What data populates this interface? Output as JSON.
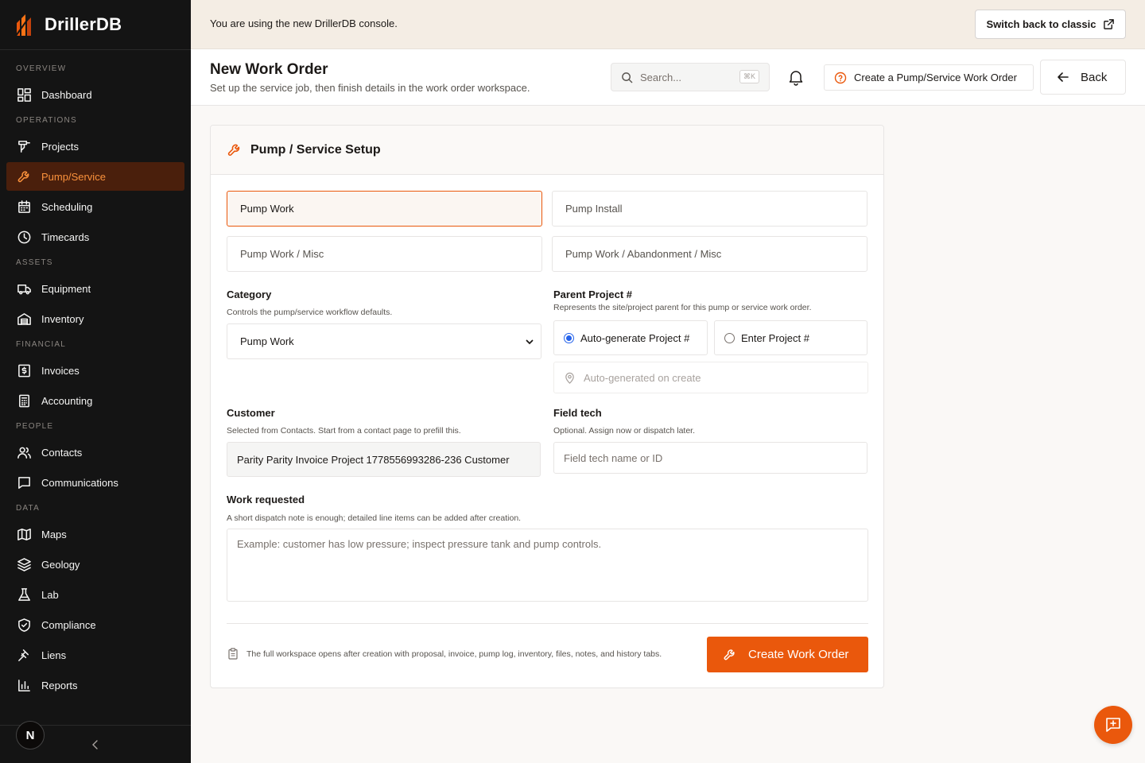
{
  "app": {
    "name": "DrillerDB"
  },
  "sidebar": {
    "sections": [
      {
        "label": "OVERVIEW",
        "items": [
          {
            "label": "Dashboard",
            "icon": "dashboard-icon"
          }
        ]
      },
      {
        "label": "OPERATIONS",
        "items": [
          {
            "label": "Projects",
            "icon": "drill-rig-icon"
          },
          {
            "label": "Pump/Service",
            "icon": "wrench-icon",
            "active": true
          },
          {
            "label": "Scheduling",
            "icon": "calendar-icon"
          },
          {
            "label": "Timecards",
            "icon": "clock-icon"
          }
        ]
      },
      {
        "label": "ASSETS",
        "items": [
          {
            "label": "Equipment",
            "icon": "truck-icon"
          },
          {
            "label": "Inventory",
            "icon": "warehouse-icon"
          }
        ]
      },
      {
        "label": "FINANCIAL",
        "items": [
          {
            "label": "Invoices",
            "icon": "invoice-icon"
          },
          {
            "label": "Accounting",
            "icon": "calculator-icon"
          }
        ]
      },
      {
        "label": "PEOPLE",
        "items": [
          {
            "label": "Contacts",
            "icon": "users-icon"
          },
          {
            "label": "Communications",
            "icon": "message-icon"
          }
        ]
      },
      {
        "label": "DATA",
        "items": [
          {
            "label": "Maps",
            "icon": "map-icon"
          },
          {
            "label": "Geology",
            "icon": "layers-icon"
          },
          {
            "label": "Lab",
            "icon": "flask-icon"
          },
          {
            "label": "Compliance",
            "icon": "shield-icon"
          },
          {
            "label": "Liens",
            "icon": "gavel-icon"
          },
          {
            "label": "Reports",
            "icon": "bar-chart-icon"
          }
        ]
      }
    ],
    "avatar_initial": "N"
  },
  "banner": {
    "text": "You are using the new DrillerDB console.",
    "switch_label": "Switch back to classic"
  },
  "header": {
    "title": "New Work Order",
    "subtitle": "Set up the service job, then finish details in the work order workspace.",
    "search_placeholder": "Search...",
    "search_shortcut": "⌘K",
    "help_label": "Create a Pump/Service Work Order",
    "back_label": "Back"
  },
  "form": {
    "title": "Pump / Service Setup",
    "work_types": [
      {
        "label": "Pump Work",
        "selected": true
      },
      {
        "label": "Pump Install",
        "selected": false
      },
      {
        "label": "Pump Work / Misc",
        "selected": false
      },
      {
        "label": "Pump Work / Abandonment / Misc",
        "selected": false
      }
    ],
    "category": {
      "label": "Category",
      "help": "Controls the pump/service workflow defaults.",
      "value": "Pump Work"
    },
    "parent_project": {
      "label": "Parent Project #",
      "help": "Represents the site/project parent for this pump or service work order.",
      "option_auto": "Auto-generate Project #",
      "option_enter": "Enter Project #",
      "selected": "auto",
      "auto_placeholder": "Auto-generated on create"
    },
    "customer": {
      "label": "Customer",
      "help": "Selected from Contacts. Start from a contact page to prefill this.",
      "value": "Parity Parity Invoice Project 1778556993286-236 Customer"
    },
    "field_tech": {
      "label": "Field tech",
      "help": "Optional. Assign now or dispatch later.",
      "placeholder": "Field tech name or ID"
    },
    "work_requested": {
      "label": "Work requested",
      "help": "A short dispatch note is enough; detailed line items can be added after creation.",
      "placeholder": "Example: customer has low pressure; inspect pressure tank and pump controls."
    },
    "footer_note": "The full workspace opens after creation with proposal, invoice, pump log, inventory, files, notes, and history tabs.",
    "submit_label": "Create Work Order"
  },
  "colors": {
    "accent": "#ea580c",
    "sidebar_bg": "#141414",
    "banner_bg": "#f4ede4",
    "active_nav_bg": "#4a1f0c"
  }
}
